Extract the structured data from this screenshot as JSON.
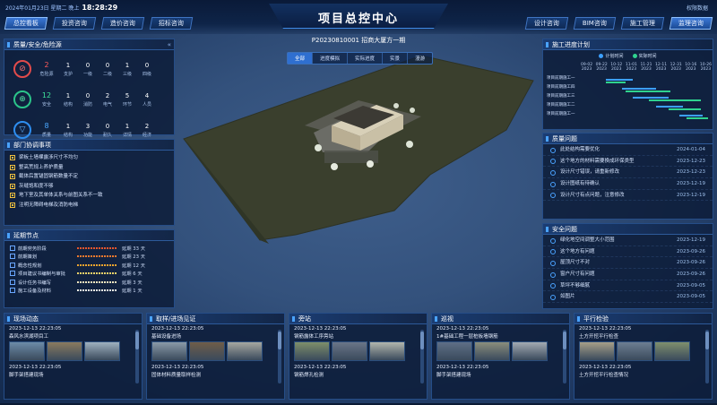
{
  "header": {
    "date": "2024年01月23日 星期二 晚上",
    "time": "18:28:29",
    "title": "项目总控中心",
    "user_link": "权限数据",
    "left_tabs": [
      "总控看板",
      "投资咨询",
      "造价咨询",
      "招标咨询"
    ],
    "right_tabs": [
      "设计咨询",
      "BIM咨询",
      "施工管理",
      "监理咨询"
    ]
  },
  "center": {
    "project": "P20230810001 招商大厦方一期",
    "tabs": [
      "全部",
      "进度模拟",
      "实际进度",
      "实景",
      "漫游"
    ]
  },
  "safety": {
    "title": "质量/安全/危险源",
    "rows": [
      {
        "icon": "⊘",
        "color": "red",
        "first": {
          "v": "2",
          "l": "危险源"
        },
        "cells": [
          {
            "v": "1",
            "l": "支护"
          },
          {
            "v": "0",
            "l": "一级"
          },
          {
            "v": "0",
            "l": "二级"
          },
          {
            "v": "1",
            "l": "三级"
          },
          {
            "v": "0",
            "l": "四级"
          }
        ]
      },
      {
        "icon": "⊕",
        "color": "green",
        "first": {
          "v": "12",
          "l": "安全"
        },
        "cells": [
          {
            "v": "1",
            "l": "结构"
          },
          {
            "v": "0",
            "l": "消防"
          },
          {
            "v": "2",
            "l": "电气"
          },
          {
            "v": "5",
            "l": "环节"
          },
          {
            "v": "4",
            "l": "人员"
          }
        ]
      },
      {
        "icon": "▽",
        "color": "blue",
        "first": {
          "v": "8",
          "l": "质量"
        },
        "cells": [
          {
            "v": "1",
            "l": "结构"
          },
          {
            "v": "3",
            "l": "功能"
          },
          {
            "v": "0",
            "l": "耐久"
          },
          {
            "v": "1",
            "l": "详情"
          },
          {
            "v": "2",
            "l": "经济"
          }
        ]
      }
    ]
  },
  "coord": {
    "title": "部门协调事项",
    "items": [
      "梁板土墙裸露涉尺寸不均匀",
      "整高荒规上养护质量",
      "截体后置锚固钢筋数量不定",
      "灰缝饱和度不够",
      "地下室及其单体关系与前图关系不一致",
      "注明无障碍电梯及消防电梯"
    ]
  },
  "milestones": {
    "title": "延期节点",
    "items": [
      {
        "name": "前期劳务阶段",
        "delay": "延期 33 天",
        "color": "#e8562c"
      },
      {
        "name": "前期策划",
        "delay": "延期 23 天",
        "color": "#f07a2e"
      },
      {
        "name": "概念性规划",
        "delay": "延期 12 天",
        "color": "#f0a52e"
      },
      {
        "name": "项目建议书编制与审批",
        "delay": "延期 6 天",
        "color": "#f3d36a"
      },
      {
        "name": "设计任务书编写",
        "delay": "延期 3 天",
        "color": "#f5e7c0"
      },
      {
        "name": "施工设备及材料",
        "delay": "延期 1 天",
        "color": "#f7f2e4"
      }
    ]
  },
  "gantt": {
    "title": "施工进度计划",
    "legend": [
      "计划时间",
      "实际时间"
    ],
    "dates": [
      [
        "09-02",
        "2023"
      ],
      [
        "09-22",
        "2023"
      ],
      [
        "10-12",
        "2023"
      ],
      [
        "11-01",
        "2023"
      ],
      [
        "11-21",
        "2023"
      ],
      [
        "12-11",
        "2023"
      ],
      [
        "12-31",
        "2023"
      ],
      [
        "10-16",
        "2023"
      ],
      [
        "10-26",
        "2023"
      ]
    ],
    "tasks": [
      "项目前期施工一",
      "项目前期施工四",
      "项目前期施工三",
      "项目前期施工二",
      "项目前期施工一"
    ]
  },
  "quality": {
    "title": "质量问题",
    "items": [
      {
        "t": "此处结构需要优化",
        "d": "2024-01-04"
      },
      {
        "t": "这个地方的材料需要换成环保类型",
        "d": "2023-12-23"
      },
      {
        "t": "设计尺寸错误，请重新修改",
        "d": "2023-12-23"
      },
      {
        "t": "设计图纸有待确认",
        "d": "2023-12-19"
      },
      {
        "t": "设计尺寸有点问题，注意修改",
        "d": "2023-12-19"
      }
    ]
  },
  "security": {
    "title": "安全问题",
    "items": [
      {
        "t": "绿化地空间调整大小范围",
        "d": "2023-12-19"
      },
      {
        "t": "这个地方有问题",
        "d": "2023-09-26"
      },
      {
        "t": "屋顶尺寸不对",
        "d": "2023-09-26"
      },
      {
        "t": "窗户尺寸有问题",
        "d": "2023-09-26"
      },
      {
        "t": "草坪不够细腻",
        "d": "2023-09-05"
      },
      {
        "t": "如图片",
        "d": "2023-09-05"
      }
    ]
  },
  "bottom": [
    {
      "title": "现场动态",
      "e1": {
        "ts": "2023-12-13 22:23:05",
        "desc": "森风水滨湖项目工"
      },
      "e2": {
        "ts": "2023-12-13 22:23:05",
        "desc": "脚手架搭建现场"
      }
    },
    {
      "title": "取样/进场见证",
      "e1": {
        "ts": "2023-12-13 22:23:05",
        "desc": "基础设备进场"
      },
      "e2": {
        "ts": "2023-12-13 22:23:05",
        "desc": "固体材料质量取样检测"
      }
    },
    {
      "title": "旁站",
      "e1": {
        "ts": "2023-12-13 22:23:05",
        "desc": "钢筋露体工序旁站"
      },
      "e2": {
        "ts": "2023-12-13 22:23:05",
        "desc": "钢筋焊孔检测"
      }
    },
    {
      "title": "巡视",
      "e1": {
        "ts": "2023-12-13 22:23:05",
        "desc": "1#基础工程一层桩板墙钢筋"
      },
      "e2": {
        "ts": "2023-12-13 22:23:05",
        "desc": "脚手架搭建现场"
      }
    },
    {
      "title": "平行检验",
      "e1": {
        "ts": "2023-12-13 22:23:05",
        "desc": "土方开挖平行检查"
      },
      "e2": {
        "ts": "2023-12-13 22:23:05",
        "desc": "土方开挖平行检查情况"
      }
    }
  ]
}
